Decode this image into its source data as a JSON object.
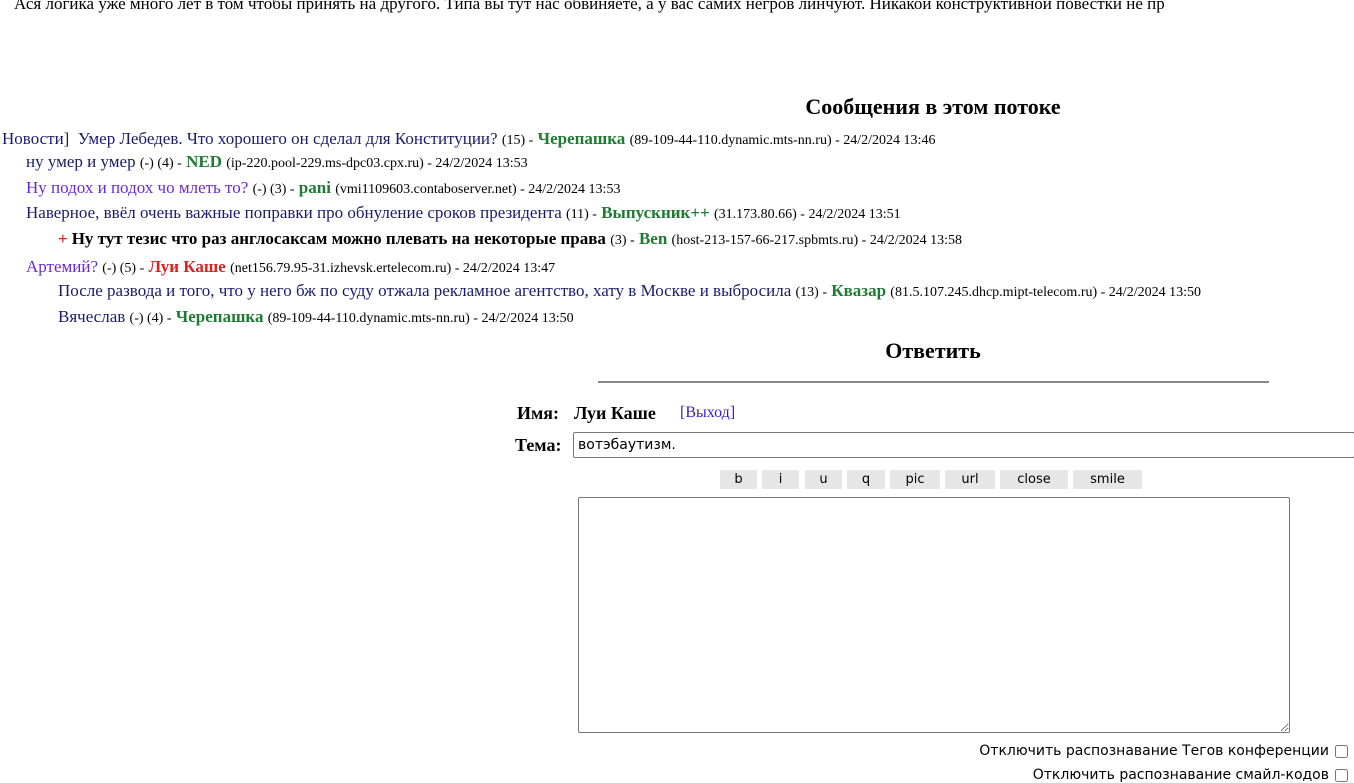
{
  "top_text": "Ася логика уже много лет в том чтобы принять на другого. Типа вы тут нас обвиняете, а у вас самих негров линчуют. Никакой конструктивной повестки не пр",
  "thread": {
    "heading": "Сообщения в этом потоке",
    "items": [
      {
        "prefix": "Новости]",
        "title": "Умер Лебедев. Что хорошего он сделал для Конституции?",
        "meta": "(15) -",
        "author": "Черепашка",
        "host": "(89-109-44-110.dynamic.mts-nn.ru) - 24/2/2024 13:46"
      },
      {
        "title": "ну умер и умер",
        "meta": "(-) (4) -",
        "author": "NED",
        "host": "(ip-220.pool-229.ms-dpc03.cpx.ru) - 24/2/2024 13:53"
      },
      {
        "title": "Ну подох и подох чо млеть то?",
        "meta": "(-) (3) -",
        "author": "pani",
        "host": "(vmi1109603.contaboserver.net) - 24/2/2024 13:53"
      },
      {
        "title": "Наверное, ввёл очень важные поправки про обнуление сроков президента",
        "meta": "(11) -",
        "author": "Выпускник++",
        "host": "(31.173.80.66) - 24/2/2024 13:51"
      },
      {
        "plus": "+",
        "title": "Ну тут тезис что раз англосаксам можно плевать на некоторые права",
        "meta": "(3) -",
        "author": "Ben",
        "host": "(host-213-157-66-217.spbmts.ru) - 24/2/2024 13:58"
      },
      {
        "title": "Артемий?",
        "meta": "(-) (5) -",
        "author": "Луи Каше",
        "host": "(net156.79.95-31.izhevsk.ertelecom.ru) - 24/2/2024 13:47"
      },
      {
        "title": "После развода и того, что у него бж по суду отжала рекламное агентство, хату в Москве и выбросила",
        "meta": "(13) -",
        "author": "Квазар",
        "host": "(81.5.107.245.dhcp.mipt-telecom.ru) - 24/2/2024 13:50"
      },
      {
        "title": "Вячеслав",
        "meta": "(-) (4) -",
        "author": "Черепашка",
        "host": "(89-109-44-110.dynamic.mts-nn.ru) - 24/2/2024 13:50"
      }
    ]
  },
  "reply": {
    "heading": "Ответить",
    "name_label": "Имя:",
    "name_value": "Луи Каше",
    "logout": "[Выход]",
    "subject_label": "Тема:",
    "subject_value": "вотэбаутизм.",
    "toolbar": [
      "b",
      "i",
      "u",
      "q",
      "pic",
      "url",
      "close",
      "smile"
    ],
    "message_value": "",
    "option_tags": "Отключить распознавание Тегов конференции",
    "option_smiles": "Отключить распознавание смайл-кодов"
  },
  "colors": {
    "link": "#3a1ccf",
    "author": "#1f7a33",
    "author_self": "#e02020"
  }
}
